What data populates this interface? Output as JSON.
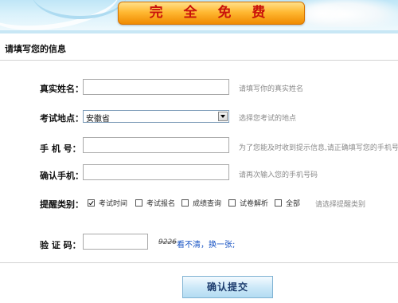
{
  "banner": {
    "title": "完 全 免 费"
  },
  "section": {
    "title": "请填写您的信息"
  },
  "form": {
    "name": {
      "label": "真实姓名：",
      "value": "",
      "hint": "请填写你的真实姓名"
    },
    "location": {
      "label": "考试地点：",
      "selected": "安徽省",
      "hint": "选择您考试的地点"
    },
    "phone": {
      "label": "手 机 号：",
      "value": "",
      "hint": "为了您能及时收到提示信息,请正确填写您的手机号"
    },
    "confirm_phone": {
      "label": "确认手机：",
      "value": "",
      "hint": "请再次输入您的手机号码"
    },
    "reminder": {
      "label": "提醒类别：",
      "options": [
        {
          "label": "考试时间",
          "checked": true
        },
        {
          "label": "考试报名",
          "checked": false
        },
        {
          "label": "成绩查询",
          "checked": false
        },
        {
          "label": "试卷解析",
          "checked": false
        },
        {
          "label": "全部",
          "checked": false
        }
      ],
      "hint": "请选择提醒类别"
    },
    "captcha": {
      "label": "验 证 码：",
      "value": "",
      "code": "9226",
      "refresh_link": "看不清，换一张;"
    }
  },
  "submit": {
    "label": "确认提交"
  },
  "colors": {
    "badge_text": "#c9120b",
    "badge_bg": "#ffb933",
    "link": "#1a55c4"
  }
}
